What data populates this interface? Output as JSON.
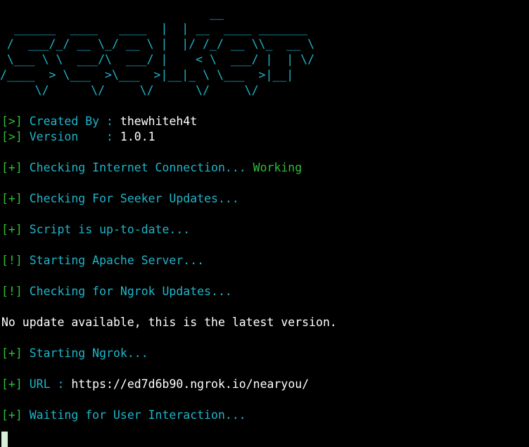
{
  "banner": {
    "lines": [
      "                              __",
      "  ______  ____   ____  |  | __  ____ _______",
      " /  ___/_/ __ \\_/ __ \\ |  |/ /_/ __ \\\\_  __ \\",
      " \\___ \\ \\  ___/\\  ___/ |    < \\  ___/ |  | \\/",
      "/____  > \\___  >\\___  >|__|_ \\ \\___  >|__|",
      "     \\/      \\/     \\/      \\/     \\/"
    ]
  },
  "info": {
    "created_prefix": "[>]",
    "created_label": "Created By",
    "created_sep": " : ",
    "created_value": "thewhiteh4t",
    "version_prefix": "[>]",
    "version_label": "Version   ",
    "version_sep": " : ",
    "version_value": "1.0.1"
  },
  "log": {
    "internet_prefix": "[+]",
    "internet_text": "Checking Internet Connection...",
    "internet_status": "Working",
    "updates_prefix": "[+]",
    "updates_text": "Checking For Seeker Updates...",
    "uptodate_prefix": "[+]",
    "uptodate_text": "Script is up-to-date...",
    "apache_prefix": "[!]",
    "apache_text": "Starting Apache Server...",
    "ngrok_updates_prefix": "[!]",
    "ngrok_updates_text": "Checking for Ngrok Updates...",
    "no_update_text": "No update available, this is the latest version.",
    "ngrok_start_prefix": "[+]",
    "ngrok_start_text": "Starting Ngrok...",
    "url_prefix": "[+]",
    "url_label": "URL",
    "url_sep": " : ",
    "url_value": "https://ed7d6b90.ngrok.io/nearyou/",
    "waiting_prefix": "[+]",
    "waiting_text": "Waiting for User Interaction..."
  },
  "colors": {
    "background": "#000000",
    "banner": "#1fb5c9",
    "prefix": "#2fbf3a",
    "text": "#1fb5c9",
    "value": "#ffffff",
    "status_ok": "#2fbf3a"
  }
}
